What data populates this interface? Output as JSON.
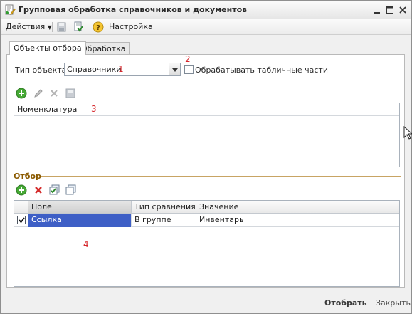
{
  "window": {
    "title": "Групповая обработка справочников и документов"
  },
  "toolbar": {
    "actions_label": "Действия",
    "settings_label": "Настройка"
  },
  "tabs": [
    {
      "label": "Объекты отбора",
      "active": true
    },
    {
      "label": "Обработка",
      "active": false
    }
  ],
  "object_type": {
    "label": "Тип объекта:",
    "value": "Справочники"
  },
  "process_tabular": {
    "label": "Обрабатывать табличные части",
    "checked": false
  },
  "objects_list": {
    "items": [
      "Номенклатура"
    ]
  },
  "filter": {
    "title": "Отбор",
    "columns": [
      "Поле",
      "Тип сравнения",
      "Значение"
    ],
    "rows": [
      {
        "checked": true,
        "field": "Ссылка",
        "comparison": "В группе",
        "value": "Инвентарь"
      }
    ]
  },
  "annotations": [
    "1",
    "2",
    "3",
    "4"
  ],
  "footer": {
    "select_label": "Отобрать",
    "close_label": "Закрыть"
  },
  "colors": {
    "annotation": "#d6262b",
    "selected_cell": "#3e5fc6",
    "section_title": "#8a5a00"
  }
}
